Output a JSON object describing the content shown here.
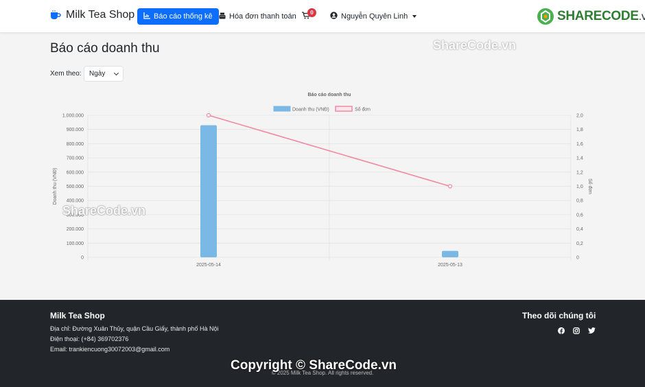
{
  "navbar": {
    "brand": "Milk Tea Shop",
    "report_label": "Báo cáo thống kê",
    "invoice_label": "Hóa đơn thanh toán",
    "cart_count": "0",
    "user_name": "Nguyễn Quyên Linh"
  },
  "watermark": {
    "logo_main": "SHARECODE",
    "logo_suffix": ".vn",
    "text": "ShareCode.vn",
    "copyright": "Copyright © ShareCode.vn"
  },
  "main": {
    "title": "Báo cáo doanh thu",
    "filter_label": "Xem theo:",
    "filter_value": "Ngày"
  },
  "chart_data": {
    "type": "bar",
    "title": "Báo cáo doanh thu",
    "categories": [
      "2025-05-14",
      "2025-05-13"
    ],
    "series": [
      {
        "name": "Doanh thu (VNĐ)",
        "type": "bar",
        "axis": "left",
        "color": "#7ab8e6",
        "values": [
          930000,
          45000
        ]
      },
      {
        "name": "Số đơn",
        "type": "line",
        "axis": "right",
        "color": "#f08aa0",
        "values": [
          2,
          1
        ]
      }
    ],
    "ylabel": "Doanh thu (VNĐ)",
    "y2label": "Số đơn",
    "ylim": [
      0,
      1000000
    ],
    "y2lim": [
      0,
      2
    ],
    "yticks": [
      "0",
      "100.000",
      "200.000",
      "300.000",
      "400.000",
      "500.000",
      "600.000",
      "700.000",
      "800.000",
      "900.000",
      "1.000.000"
    ],
    "y2ticks": [
      "0",
      "0,2",
      "0,4",
      "0,6",
      "0,8",
      "1,0",
      "1,2",
      "1,4",
      "1,6",
      "1,8",
      "2,0"
    ],
    "legend_position": "top",
    "grid": true
  },
  "footer": {
    "title": "Milk Tea Shop",
    "address": "Địa chỉ: Đường Xuân Thủy, quận Cầu Giấy, thành phố Hà Nội",
    "phone": "Điện thoại: (+84) 369702376",
    "email": "Email: trankiencuong30072003@gmail.com",
    "follow_title": "Theo dõi chúng tôi",
    "copyright": "© 2025 Milk Tea Shop. All rights reserved."
  }
}
